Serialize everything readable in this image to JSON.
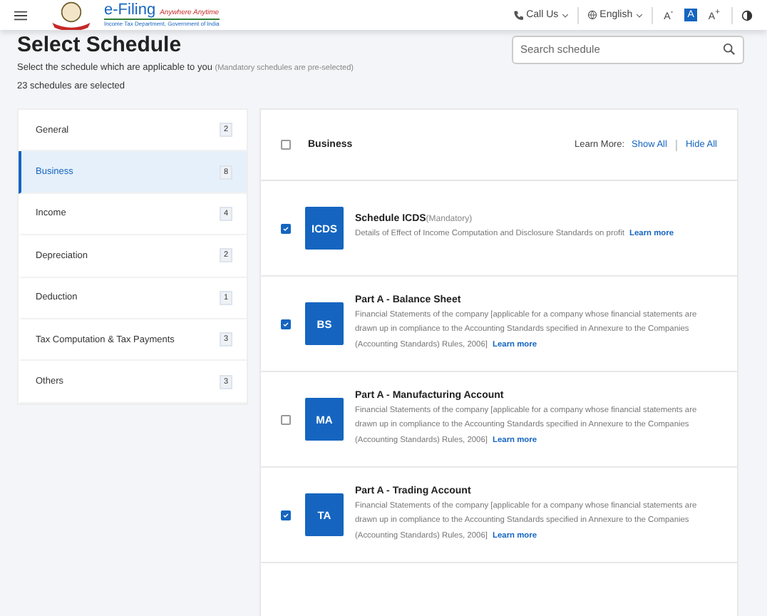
{
  "header": {
    "brand": {
      "name": "e-Filing",
      "tagline": "Anywhere Anytime",
      "department": "Income Tax Department, Government of India"
    },
    "call_us": "Call Us",
    "language": "English",
    "font_sizes": [
      {
        "label": "A$^{-}$",
        "selected": false
      },
      {
        "label": "A",
        "selected": true
      },
      {
        "label": "A$^{+}$",
        "selected": false
      }
    ]
  },
  "page": {
    "title": "Select Schedule",
    "subtitle": "Select the schedule which are applicable to you",
    "subtitle_note": "(Mandatory schedules are pre-selected)",
    "selected_count": "23 schedules are selected",
    "search": {
      "placeholder": "Search schedule"
    }
  },
  "categories": [
    {
      "label": "General",
      "count": "2",
      "selected": false
    },
    {
      "label": "Business",
      "count": "8",
      "selected": true
    },
    {
      "label": "Income",
      "count": "4",
      "selected": false
    },
    {
      "label": "Depreciation",
      "count": "2",
      "selected": false
    },
    {
      "label": "Deduction",
      "count": "1",
      "selected": false
    },
    {
      "label": "Tax Computation & Tax Payments",
      "count": "3",
      "selected": false
    },
    {
      "label": "Others",
      "count": "3",
      "selected": false
    }
  ],
  "section": {
    "title": "Business",
    "checked": false,
    "learn_more_label": "Learn More:",
    "show_all": "Show All",
    "hide_all": "Hide All"
  },
  "schedules": [
    {
      "code": "ICDS",
      "title": "Schedule ICDS",
      "note": "(Mandatory)",
      "description": "Details of Effect of Income Computation and Disclosure Standards on profit",
      "link": "Learn more",
      "checked": true
    },
    {
      "code": "BS",
      "title": "Part A - Balance Sheet",
      "description": "Financial Statements of the company [applicable for a company whose financial statements are drawn up in compliance to the Accounting Standards specified in Annexure to the Companies (Accounting Standards) Rules, 2006]",
      "link": "Learn more",
      "checked": true
    },
    {
      "code": "MA",
      "title": "Part A - Manufacturing Account",
      "description": "Financial Statements of the company [applicable for a company whose financial statements are drawn up in compliance to the Accounting Standards specified in Annexure to the Companies (Accounting Standards) Rules, 2006]",
      "link": "Learn more",
      "checked": false
    },
    {
      "code": "TA",
      "title": "Part A - Trading Account",
      "description": "Financial Statements of the company [applicable for a company whose financial statements are drawn up in compliance to the Accounting Standards specified in Annexure to the Companies (Accounting Standards) Rules, 2006]",
      "link": "Learn more",
      "checked": true
    }
  ]
}
